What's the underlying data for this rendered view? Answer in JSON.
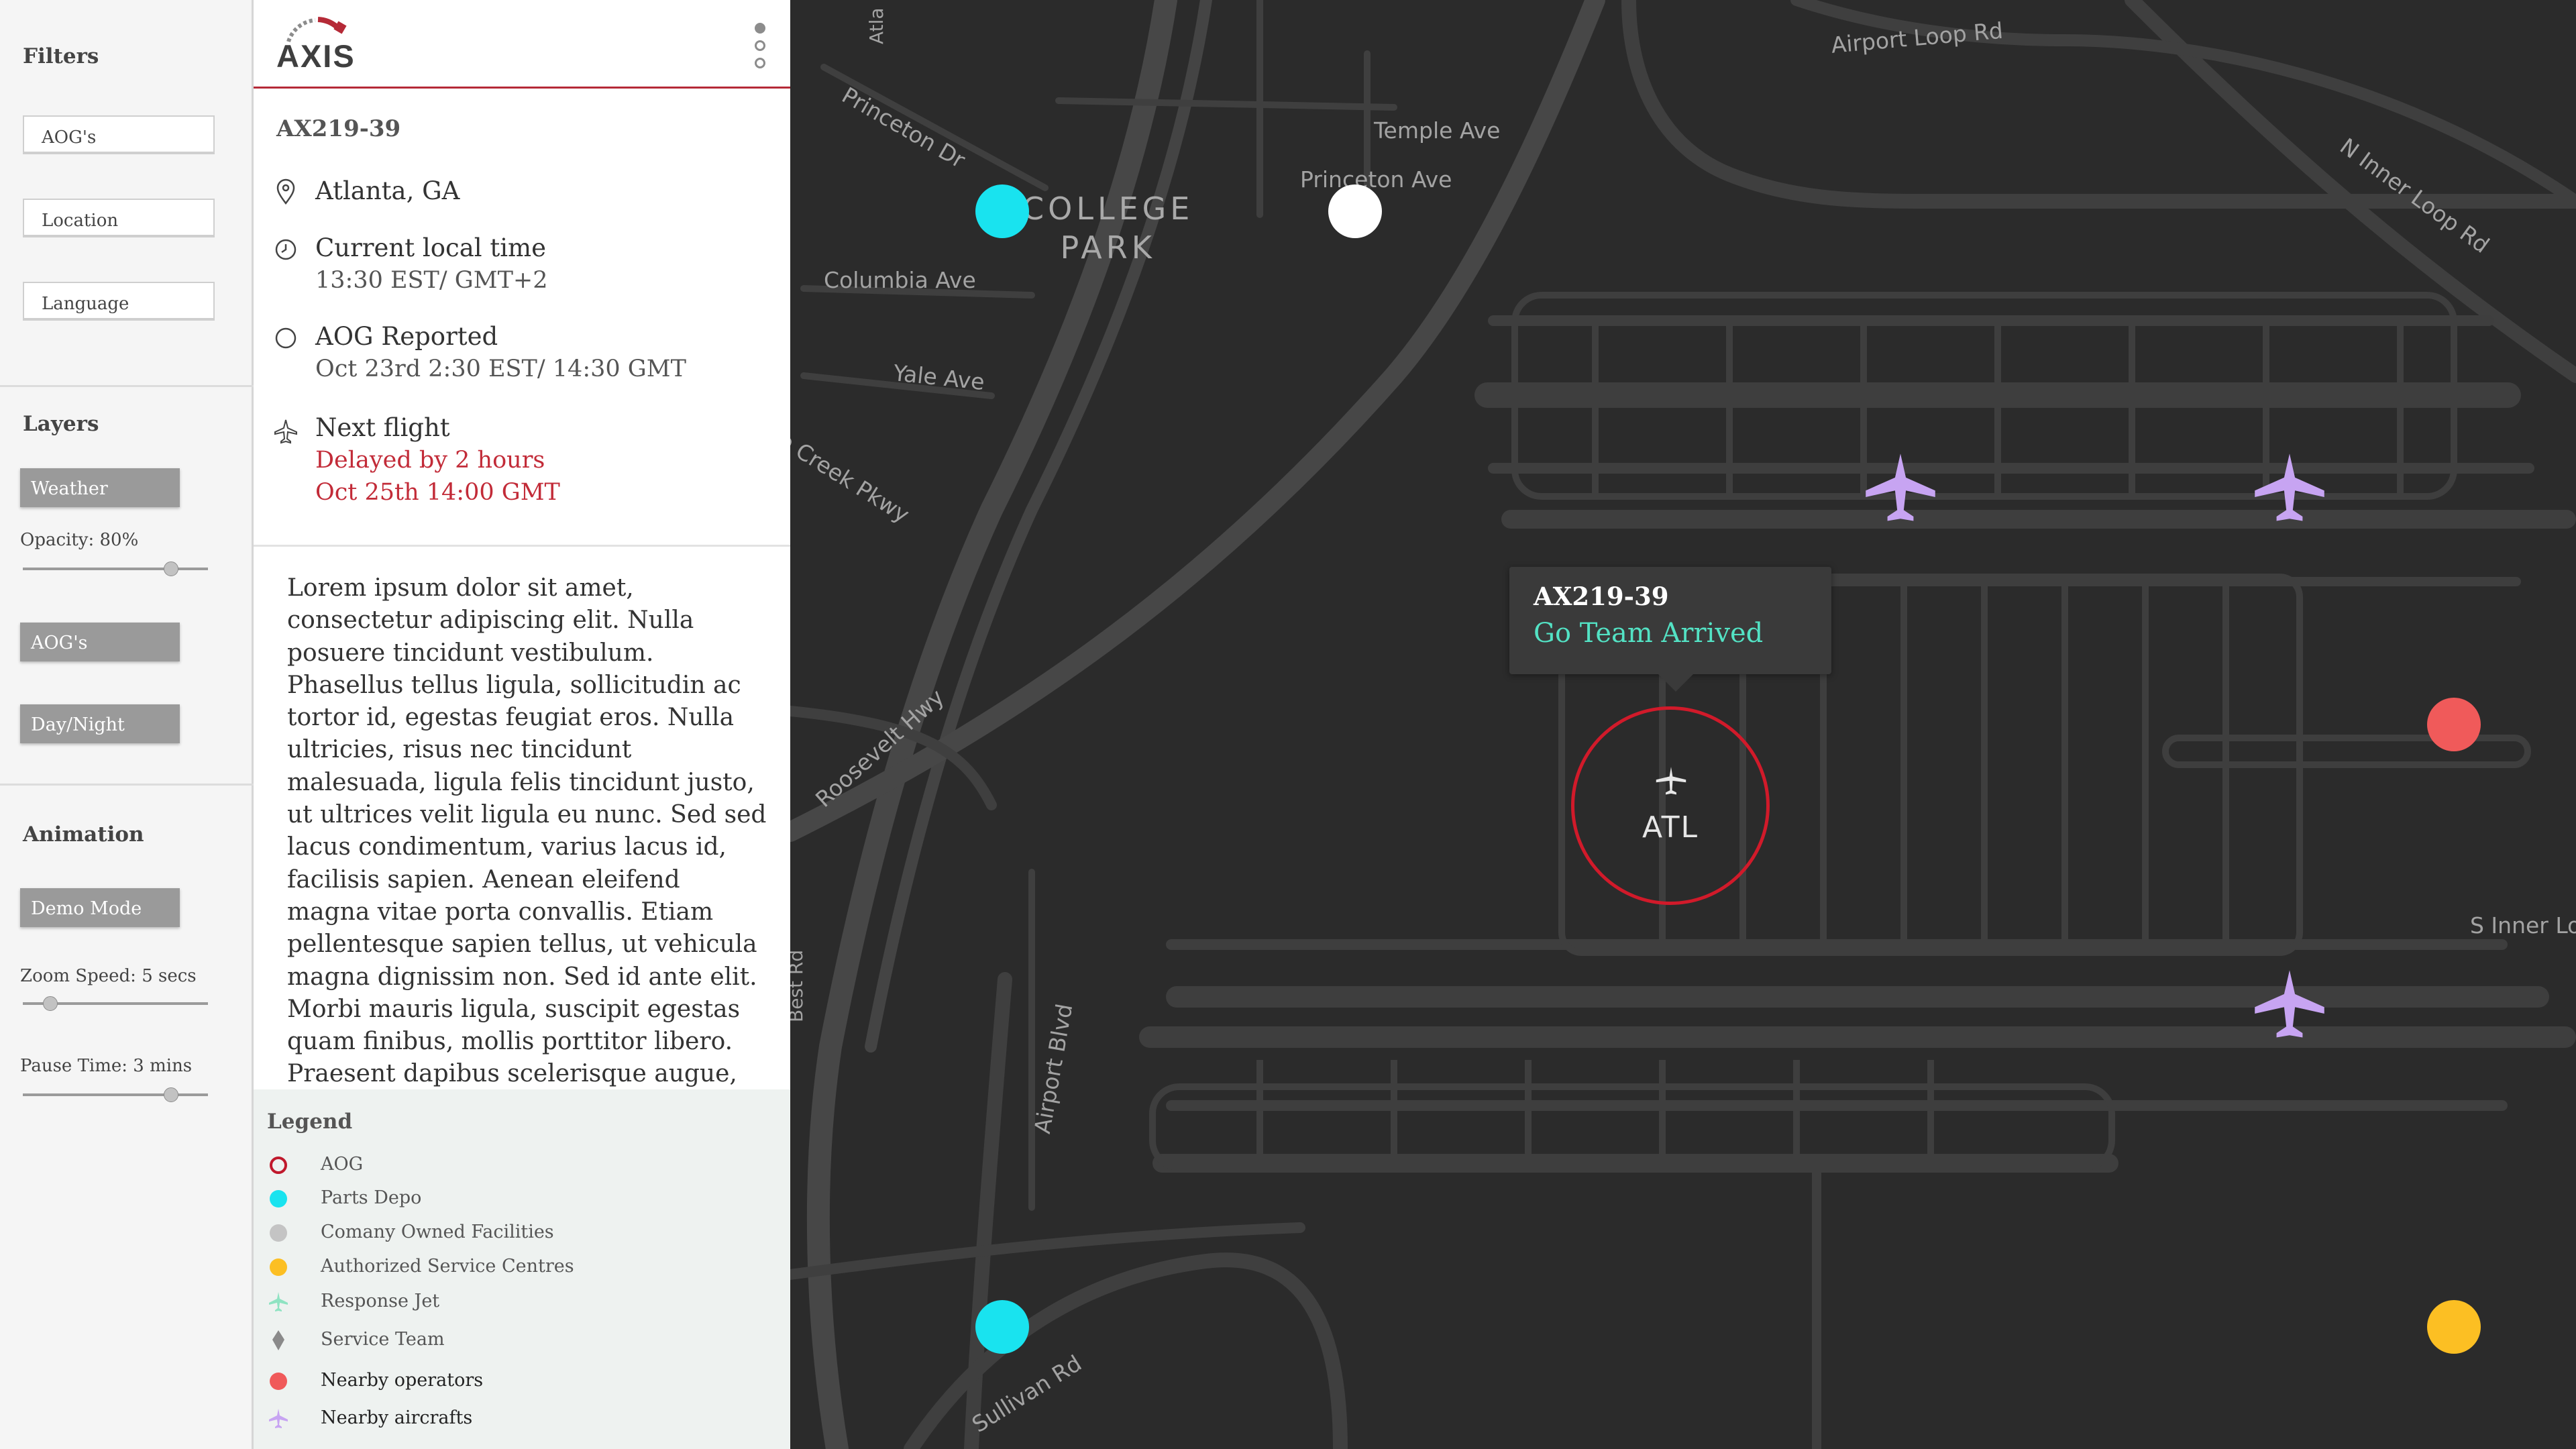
{
  "filters": {
    "heading": "Filters",
    "inputs": [
      {
        "value": "AOG's"
      },
      {
        "value": "Location"
      },
      {
        "value": "Language"
      }
    ]
  },
  "layers": {
    "heading": "Layers",
    "weather_button": "Weather",
    "opacity_label": "Opacity: 80%",
    "opacity_value": 0.8,
    "aogs_button": "AOG's",
    "daynight_button": "Day/Night"
  },
  "animation": {
    "heading": "Animation",
    "demo_button": "Demo Mode",
    "zoom_label": "Zoom Speed: 5 secs",
    "zoom_value": 0.15,
    "pause_label": "Pause Time: 3 mins",
    "pause_value": 0.8
  },
  "brand": {
    "logo_text": "AXIS",
    "accent": "#b52a37"
  },
  "detail": {
    "flight_id": "AX219-39",
    "location": "Atlanta, GA",
    "local_time_label": "Current local time",
    "local_time_value": "13:30 EST/ GMT+2",
    "aog_label": "AOG Reported",
    "aog_value": "Oct 23rd 2:30 EST/ 14:30 GMT",
    "next_flight_label": "Next flight",
    "next_flight_delay": "Delayed by 2 hours",
    "next_flight_time": "Oct 25th 14:00 GMT",
    "description": "Lorem ipsum dolor sit amet, consectetur adipiscing elit. Nulla posuere tincidunt vestibulum. Phasellus tellus ligula, sollicitudin ac tortor id, egestas feugiat eros. Nulla ultricies, risus nec tincidunt malesuada, ligula felis tincidunt justo, ut ultrices velit ligula eu nunc. Sed sed lacus condimentum, varius lacus id, facilisis sapien. Aenean eleifend magna vitae porta convallis. Etiam pellentesque sapien tellus, ut vehicula magna dignissim non. Sed id ante elit. Morbi mauris ligula, suscipit egestas quam finibus, mollis porttitor libero. Praesent dapibus scelerisque augue, nec luctus"
  },
  "legend": {
    "title": "Legend",
    "items": [
      {
        "label": "AOG",
        "icon": "ring-icon",
        "color": "#c0192c"
      },
      {
        "label": "Parts Depo",
        "icon": "dot-icon",
        "color": "#19e3ef"
      },
      {
        "label": "Comany Owned Facilities",
        "icon": "dot-icon",
        "color": "#c4c4c4"
      },
      {
        "label": "Authorized Service Centres",
        "icon": "dot-icon",
        "color": "#fcbf23"
      },
      {
        "label": "Response Jet",
        "icon": "plane-icon",
        "color": "#8fe3c2"
      },
      {
        "label": "Service Team",
        "icon": "pin-icon",
        "color": "#8a8a8a"
      },
      {
        "label": "Nearby operators",
        "icon": "dot-icon",
        "color": "#f05a5a"
      },
      {
        "label": "Nearby aircrafts",
        "icon": "plane-icon",
        "color": "#c7a4f2"
      }
    ]
  },
  "map": {
    "streets": {
      "airport_loop_rd": "Airport Loop Rd",
      "temple_ave": "Temple Ave",
      "princeton_ave": "Princeton Ave",
      "princeton_dr": "Princeton Dr",
      "college_park": "COLLEGE\nPARK",
      "columbia_ave": "Columbia Ave",
      "yale_ave": "Yale Ave",
      "creek_pkwy": "o Creek Pkwy",
      "roosevelt_hwy": "Roosevelt Hwy",
      "airport_blvd": "Airport Blvd",
      "best_rd": "Best Rd",
      "sullivan_rd": "Sullivan Rd",
      "n_inner_loop_rd": "N Inner Loop Rd",
      "s_inner_loop": "S Inner Lo",
      "atlanta_top": "Atla"
    },
    "tooltip": {
      "flight_id": "AX219-39",
      "status": "Go Team Arrived",
      "status_color": "#53e2c4"
    },
    "aog_marker": {
      "code": "ATL"
    },
    "colors": {
      "background": "#2b2b2b",
      "road": "#464646",
      "parts_depo": "#19e3ef",
      "facility": "#ffffff",
      "operator": "#f05a5a",
      "service_centre": "#fcbf23",
      "aircraft": "#c7a4f2"
    }
  }
}
